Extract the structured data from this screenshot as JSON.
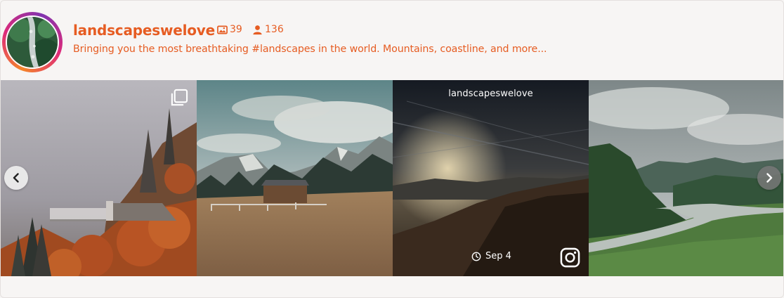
{
  "profile": {
    "username": "landscapeswelove",
    "media_count": "39",
    "followers_count": "136",
    "bio": "Bringing you the most breathtaking #landscapes in the world. Mountains, coastline, and more...",
    "accent_color": "#e65c22"
  },
  "gallery": {
    "items": [
      {
        "icon": "carousel-icon"
      },
      {},
      {
        "hover_username": "landscapeswelove",
        "hover_date": "Sep 4",
        "icon": "instagram-icon"
      },
      {}
    ],
    "nav": {
      "prev_icon": "chevron-left-icon",
      "next_icon": "chevron-right-icon"
    }
  }
}
